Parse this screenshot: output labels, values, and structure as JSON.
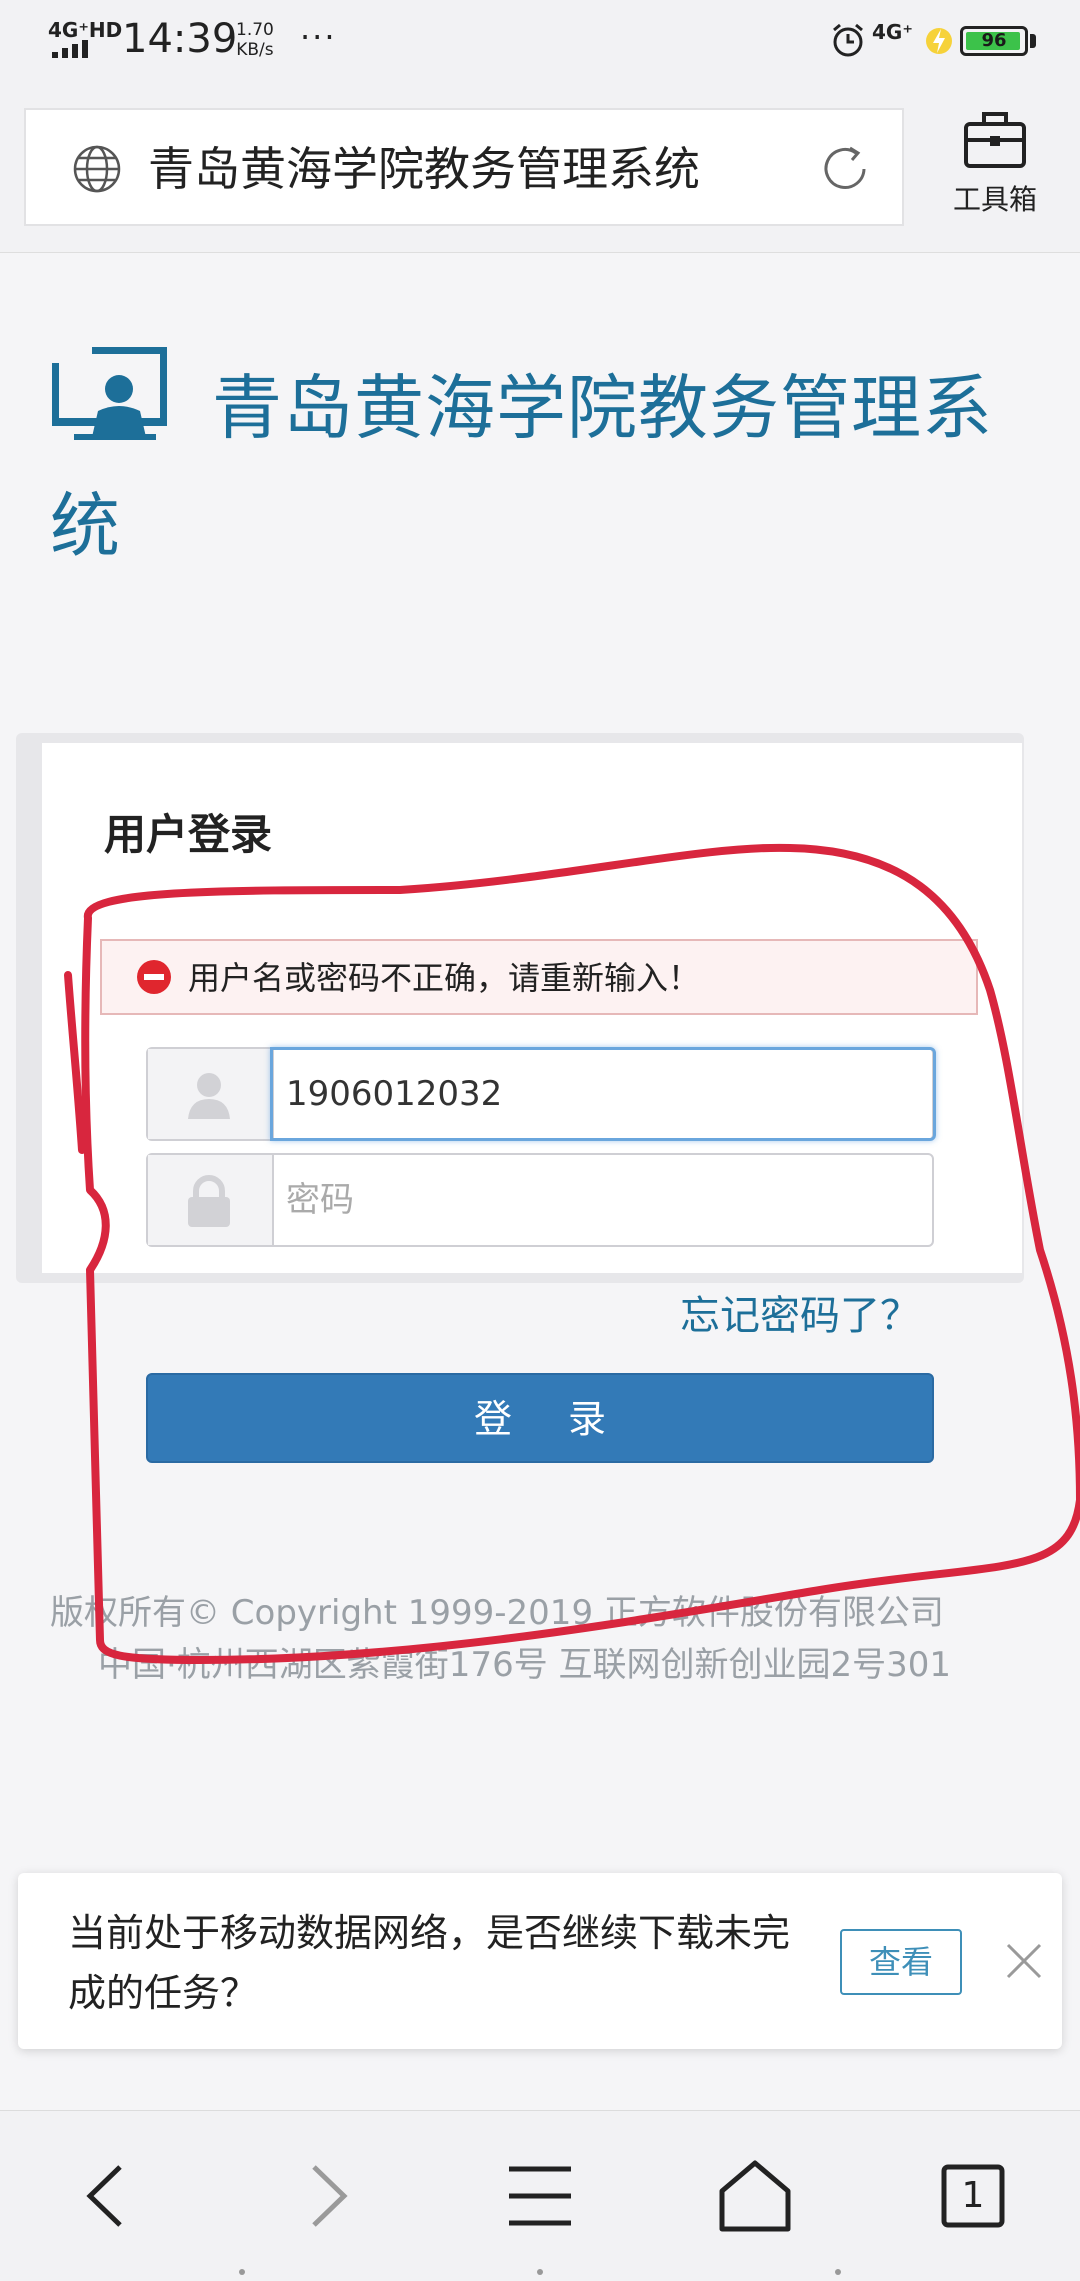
{
  "status_bar": {
    "network": "4G⁺HD",
    "time": "14:39",
    "speed_value": "1.70",
    "speed_unit": "KB/s",
    "more": "···",
    "network2": "4G⁺",
    "battery": "96"
  },
  "browser": {
    "url_title": "青岛黄海学院教务管理系统",
    "toolbox_label": "工具箱"
  },
  "page": {
    "site_title": "青岛黄海学院教务管理系统",
    "login_header": "用户登录",
    "error_message": "用户名或密码不正确，请重新输入！",
    "username_value": "1906012032",
    "password_placeholder": "密码",
    "forgot_link": "忘记密码了？",
    "login_button": "登 录",
    "copyright_line1": "版权所有© Copyright 1999-2019 正方软件股份有限公司",
    "copyright_line2": "中国·杭州西湖区紫霞街176号 互联网创新创业园2号301"
  },
  "toast": {
    "message": "当前处于移动数据网络，是否继续下载未完成的任务？",
    "view_button": "查看"
  },
  "bottom_nav": {
    "tab_count": "1"
  },
  "colors": {
    "brand_blue": "#1d6f99",
    "button_blue": "#337ab7",
    "annotation_red": "#d8263e"
  }
}
